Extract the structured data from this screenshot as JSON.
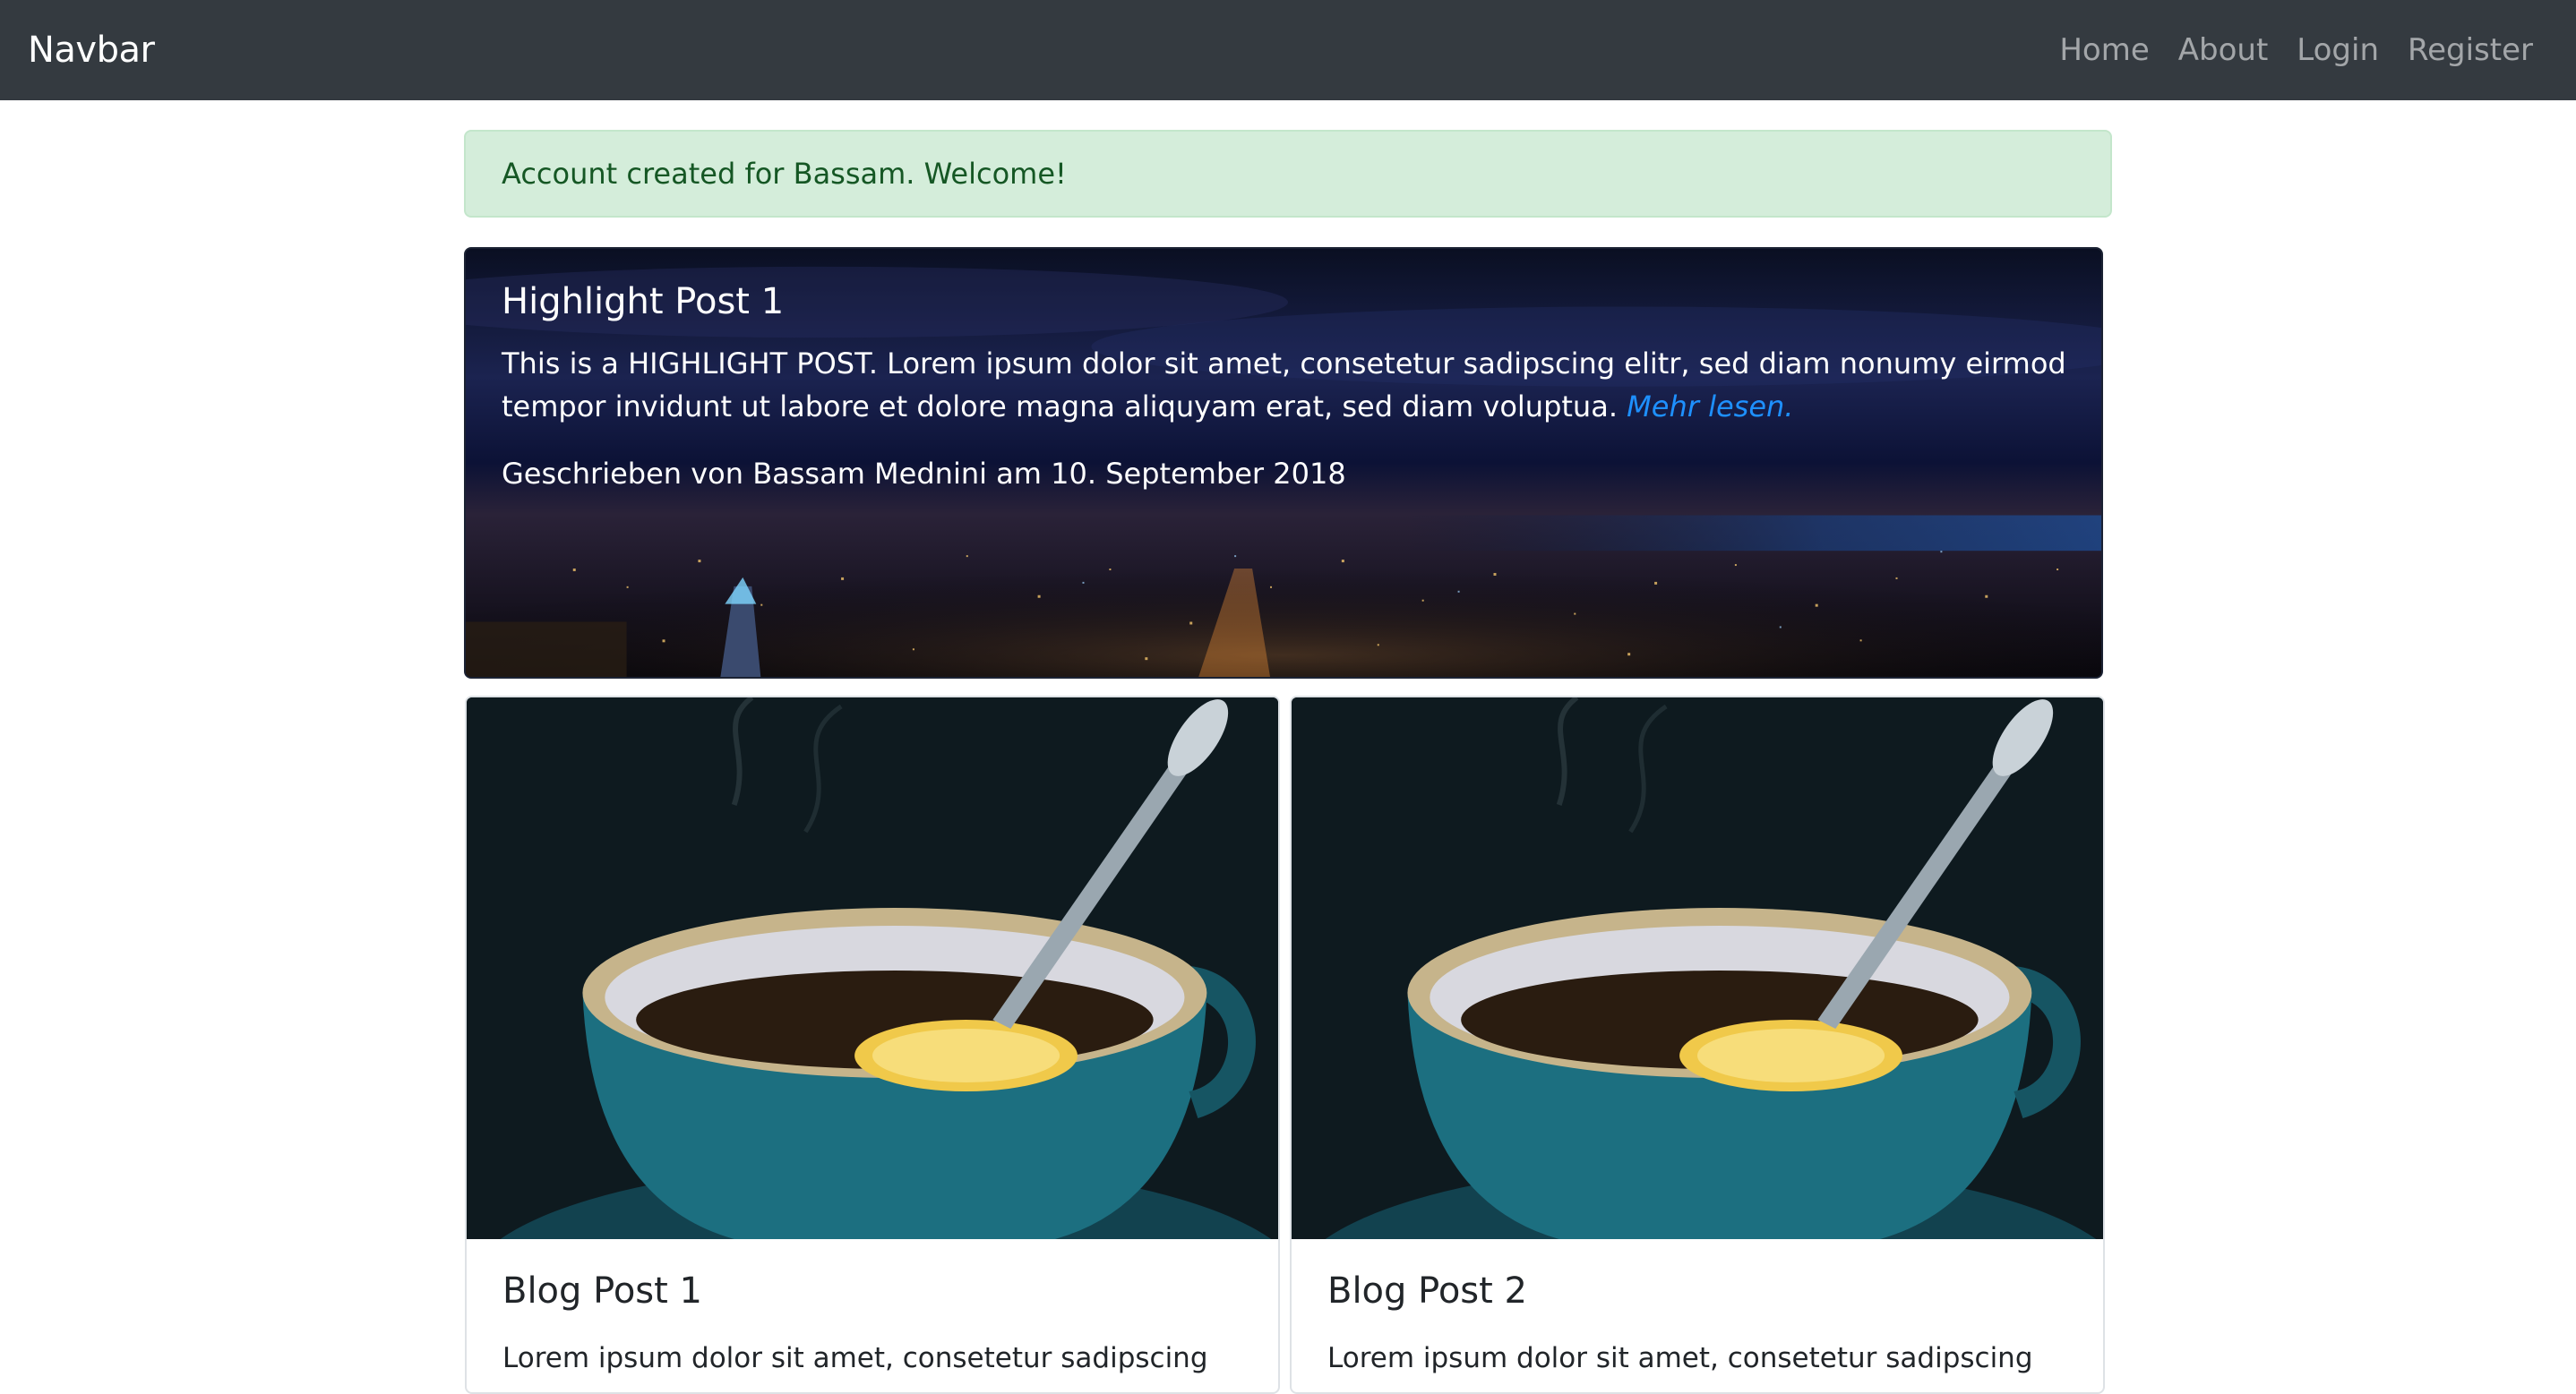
{
  "navbar": {
    "brand": "Navbar",
    "links": [
      "Home",
      "About",
      "Login",
      "Register"
    ]
  },
  "alert": {
    "message": "Account created for Bassam. Welcome!"
  },
  "highlight": {
    "title": "Highlight Post 1",
    "text": "This is a HIGHLIGHT POST. Lorem ipsum dolor sit amet, consetetur sadipscing elitr, sed diam nonumy eirmod tempor invidunt ut labore et dolore magna aliquyam erat, sed diam voluptua.",
    "read_more": "Mehr lesen.",
    "meta": "Geschrieben von Bassam Mednini am 10. September 2018"
  },
  "posts": [
    {
      "title": "Blog Post 1",
      "text": "Lorem ipsum dolor sit amet, consetetur sadipscing"
    },
    {
      "title": "Blog Post 2",
      "text": "Lorem ipsum dolor sit amet, consetetur sadipscing"
    }
  ],
  "colors": {
    "navbar_bg": "#343a40",
    "alert_bg": "#d4edda",
    "alert_text": "#155724",
    "link": "#1e90ff"
  }
}
